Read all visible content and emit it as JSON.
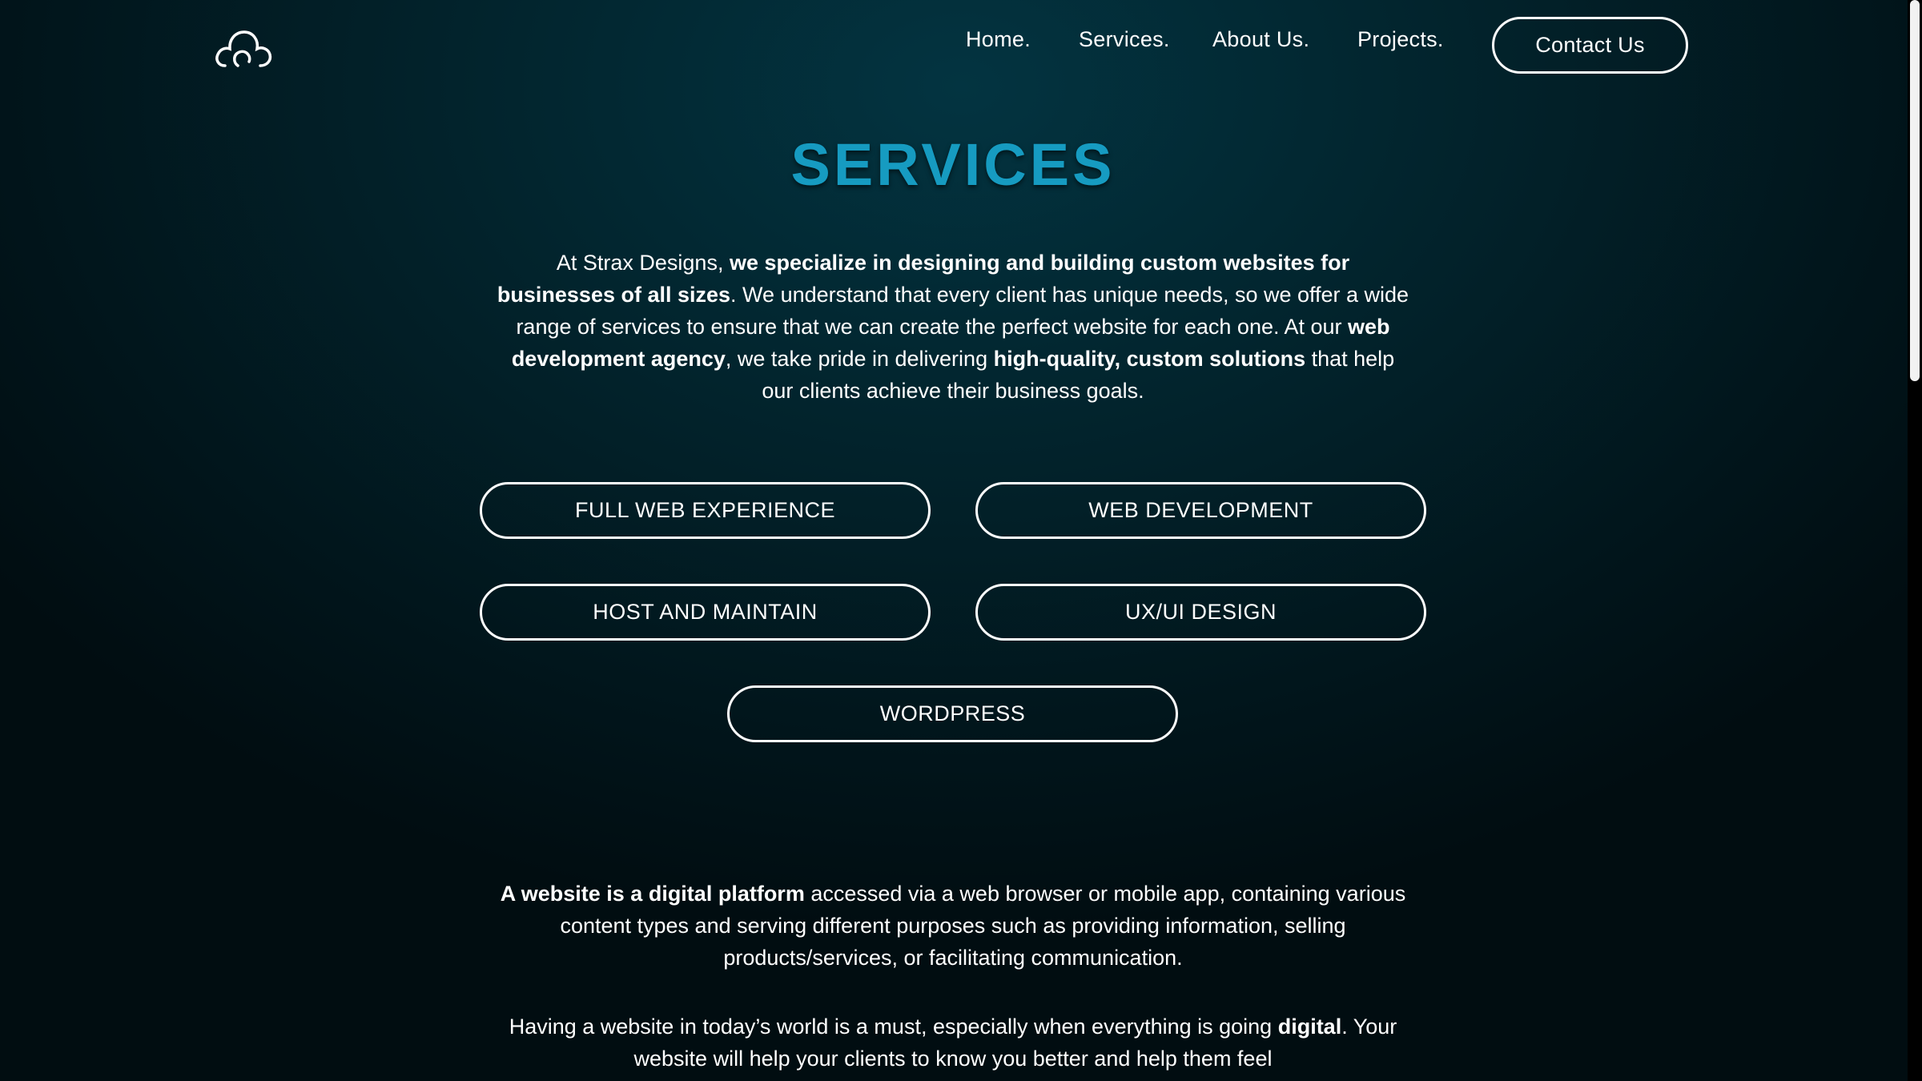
{
  "brand": {
    "logo_icon": "cloud-outline-icon"
  },
  "nav": {
    "items": [
      {
        "label": "Home."
      },
      {
        "label": "Services."
      },
      {
        "label": "About Us."
      },
      {
        "label": "Projects."
      }
    ],
    "contact_label": "Contact Us"
  },
  "hero": {
    "title": "SERVICES",
    "title_color": "#169bc1",
    "intro": {
      "t1": "At Strax Designs, ",
      "b1": "we specialize in designing and building custom websites for businesses of all sizes",
      "t2": ". We understand that every client has unique needs, so we offer a wide range of services to ensure that we can create the perfect website for each one. At our ",
      "b2": "web development agency",
      "t3": ", we take pride in delivering ",
      "b3": "high-quality, custom solutions",
      "t4": " that help our clients achieve their business goals."
    }
  },
  "services": [
    {
      "label": "FULL WEB EXPERIENCE"
    },
    {
      "label": "WEB DEVELOPMENT"
    },
    {
      "label": "HOST AND MAINTAIN"
    },
    {
      "label": "UX/UI DESIGN"
    },
    {
      "label": "WORDPRESS"
    }
  ],
  "about": {
    "p1": {
      "b1": "A website is a digital platform",
      "t1": " accessed via a web browser or mobile app, containing various content types and serving different purposes such as providing information, selling products/services, or facilitating communication."
    },
    "p2": {
      "t1": "Having a website in today’s world is a must, especially when everything is going ",
      "b1": "digital",
      "t2": ". Your website will help your clients to know you better and help them feel"
    }
  },
  "colors": {
    "background": "#02242d",
    "accent": "#169bc1",
    "text": "#ffffff"
  }
}
